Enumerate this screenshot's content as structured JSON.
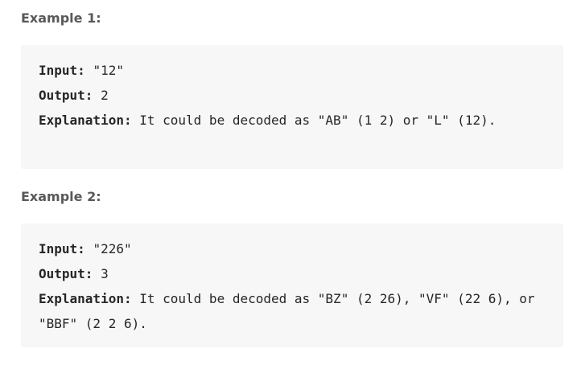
{
  "examples": [
    {
      "heading": "Example 1:",
      "input_label": "Input:",
      "input_value": "\"12\"",
      "output_label": "Output:",
      "output_value": "2",
      "explanation_label": "Explanation:",
      "explanation_value": "It could be decoded as \"AB\" (1 2) or \"L\" (12)."
    },
    {
      "heading": "Example 2:",
      "input_label": "Input:",
      "input_value": "\"226\"",
      "output_label": "Output:",
      "output_value": "3",
      "explanation_label": "Explanation:",
      "explanation_value": "It could be decoded as \"BZ\" (2 26), \"VF\" (22 6), or \"BBF\" (2 2 6)."
    }
  ]
}
